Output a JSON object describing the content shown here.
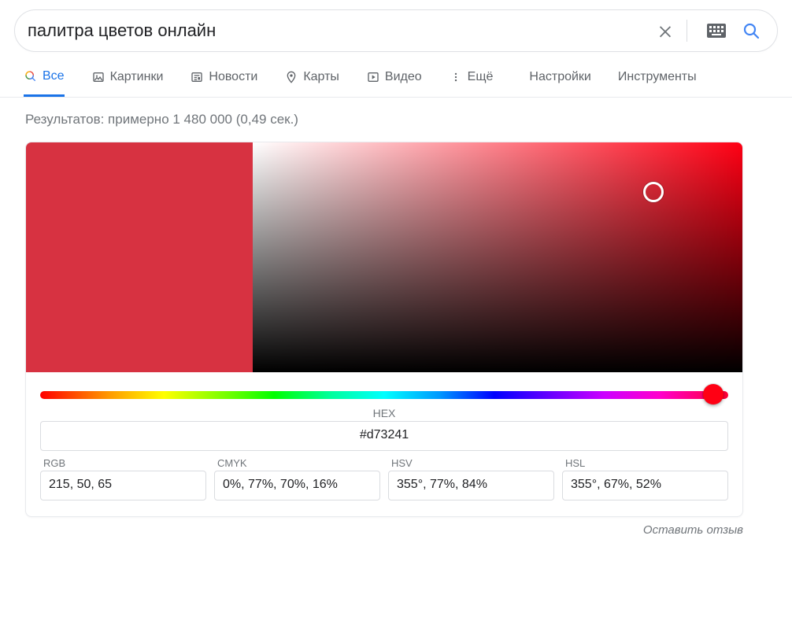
{
  "search": {
    "query": "палитра цветов онлайн"
  },
  "tabs": {
    "all": "Все",
    "images": "Картинки",
    "news": "Новости",
    "maps": "Карты",
    "video": "Видео",
    "more": "Ещё",
    "settings": "Настройки",
    "tools": "Инструменты"
  },
  "stats": "Результатов: примерно 1 480 000 (0,49 сек.)",
  "picker": {
    "swatch_color": "#d73241",
    "hue_color": "#ff0014",
    "hex_label": "HEX",
    "hex_value": "#d73241",
    "rgb_label": "RGB",
    "rgb_value": "215, 50, 65",
    "cmyk_label": "CMYK",
    "cmyk_value": "0%, 77%, 70%, 16%",
    "hsv_label": "HSV",
    "hsv_value": "355°, 77%, 84%",
    "hsl_label": "HSL",
    "hsl_value": "355°, 67%, 52%"
  },
  "feedback": "Оставить отзыв"
}
